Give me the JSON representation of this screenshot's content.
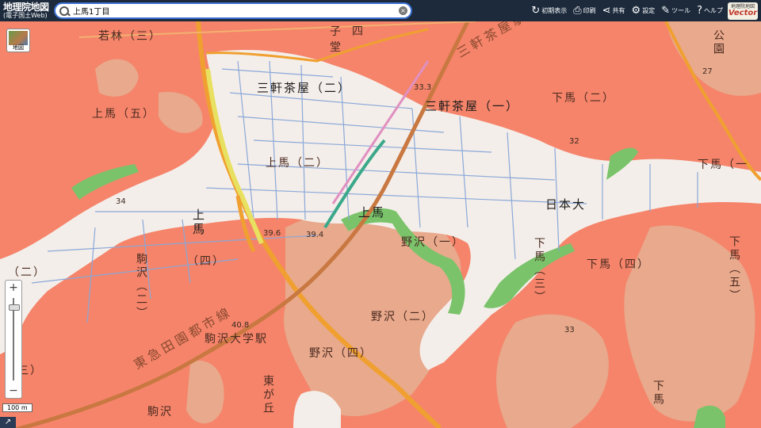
{
  "header": {
    "brand_title": "地理院地図",
    "brand_subtitle": "(電子国土Web)",
    "search_value": "上馬1丁目",
    "clear_icon": "clear-icon",
    "tools": [
      {
        "label": "初期表示",
        "icon": "↻"
      },
      {
        "label": "印刷",
        "icon": "⎙"
      },
      {
        "label": "共有",
        "icon": "⋖"
      },
      {
        "label": "設定",
        "icon": "⚙"
      },
      {
        "label": "ツール",
        "icon": "✎"
      },
      {
        "label": "ヘルプ",
        "icon": "?"
      }
    ],
    "vector_brand_top": "地理院地図",
    "vector_brand_bottom": "Vector"
  },
  "map": {
    "basemap_button_label": "地図",
    "scale_label": "100 m",
    "zoom_in": "+",
    "zoom_out": "−",
    "corner_icon": "↗",
    "labels": {
      "sangenjaya_2": "三軒茶屋（二）",
      "sangenjaya_1": "三軒茶屋（一）",
      "sangenjaya_station": "三軒茶屋駅",
      "wakabayashi_3": "若林（三）",
      "kamiuma_5": "上馬（五）",
      "kamiuma_2": "上馬（二）",
      "kamiuma_small": "上馬",
      "kamiuma_v": "上馬",
      "kamiuma_4": "（四）",
      "shimouma_2": "下馬（二）",
      "shimouma_1": "下馬（一",
      "shimouma_4": "下馬（四）",
      "shimouma_3_v": "下馬（三）",
      "shimouma_5_v": "下馬（五）",
      "shimouma_bottom": "下馬",
      "nihondai": "日本大",
      "nozawa_1": "野沢（一）",
      "nozawa_2": "野沢（二）",
      "nozawa_4": "野沢（四）",
      "komazawa_v": "駒沢（二）",
      "komazawa_3": "（三）",
      "komazawa_bottom": "駒沢",
      "komazawa_paren2": "（二）",
      "komazawa_univ_station": "駒沢大学駅",
      "toyoko_line": "東急田園都市線",
      "higashigaoka": "東が丘",
      "park": "公園",
      "park_top": "子",
      "park_do": "堂",
      "park_shi": "四"
    },
    "elevations": {
      "e1": "33.3",
      "e2": "32",
      "e3": "34",
      "e4": "39.6",
      "e5": "39.4",
      "e6": "40.8",
      "e7": "33",
      "e8": "27"
    }
  }
}
